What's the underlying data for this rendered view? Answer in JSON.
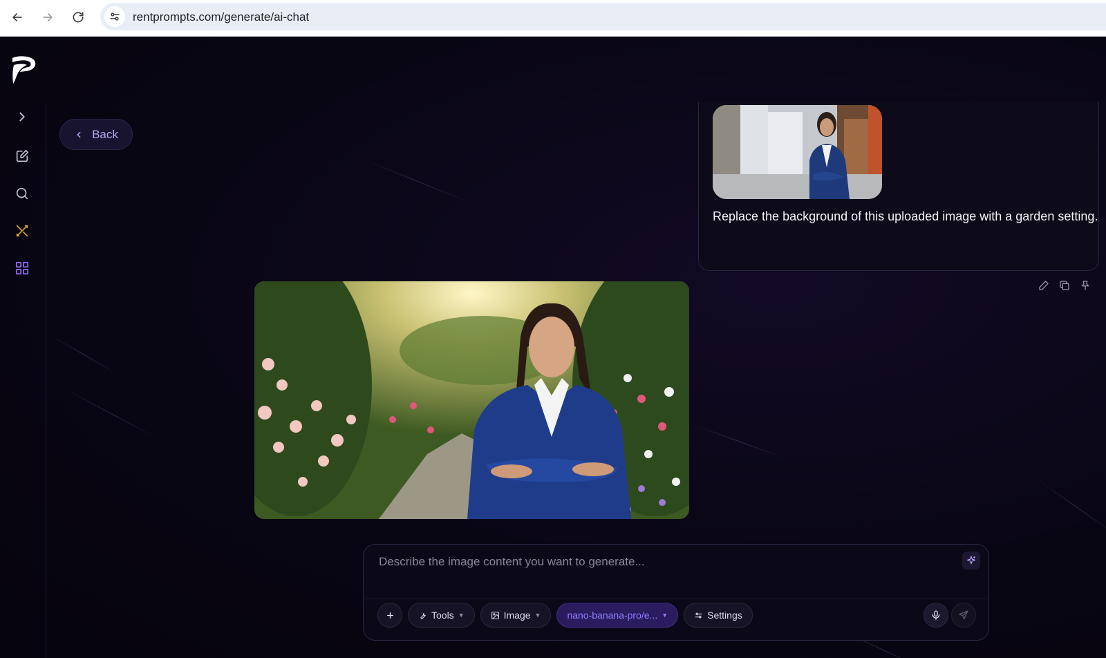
{
  "browser": {
    "url": "rentprompts.com/generate/ai-chat"
  },
  "nav": {
    "back_label": "Back"
  },
  "chat": {
    "user_message": "Replace the background of this uploaded image with a garden setting."
  },
  "prompt": {
    "placeholder": "Describe the image content you want to generate...",
    "tools_label": "Tools",
    "image_label": "Image",
    "model_label": "nano-banana-pro/e...",
    "settings_label": "Settings"
  },
  "colors": {
    "background": "#07040f",
    "accent_purple": "#8f7dff",
    "active_sidebar_icon": "#e0a82e",
    "grid_icon": "#9b6cff"
  },
  "icons": {
    "sidebar": [
      "chevron-right-icon",
      "edit-icon",
      "search-icon",
      "tools-crossed-icon",
      "grid-icon"
    ],
    "message_actions": [
      "pencil-icon",
      "copy-icon",
      "pin-icon"
    ]
  }
}
